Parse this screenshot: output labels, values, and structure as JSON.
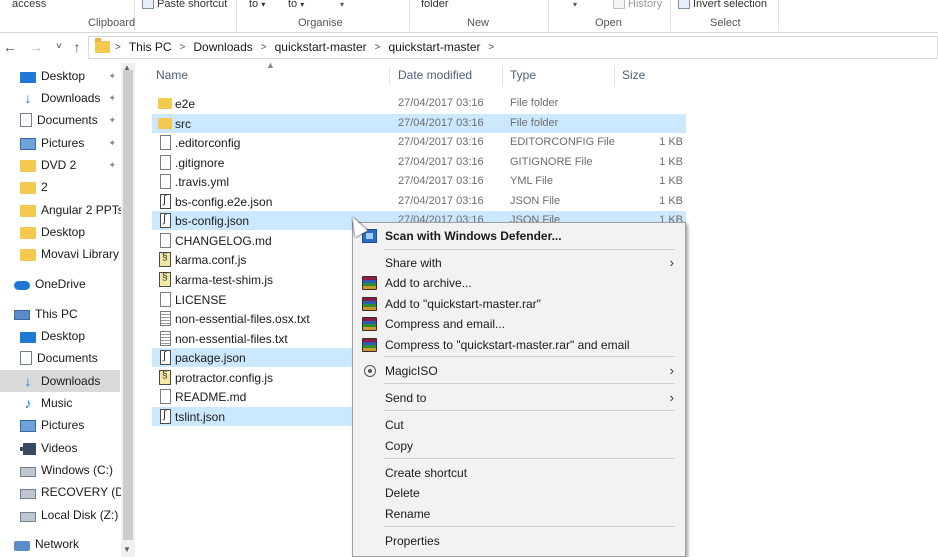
{
  "ribbon": {
    "access_label": "access",
    "paste_shortcut_label": "Paste shortcut",
    "move_to_label": "to",
    "copy_to_label": "to",
    "new_folder_label": "folder",
    "history_label": "History",
    "invert_selection_label": "Invert selection",
    "groups": {
      "clipboard": "Clipboard",
      "organise": "Organise",
      "new": "New",
      "open": "Open",
      "select": "Select"
    }
  },
  "address": {
    "back_icon": "←",
    "forward_icon": "→",
    "recent_icon": "˅",
    "up_icon": "↑",
    "crumbs": [
      "This PC",
      "Downloads",
      "quickstart-master",
      "quickstart-master"
    ],
    "sep": ">"
  },
  "sidebar": {
    "items": [
      {
        "label": "Desktop",
        "icon": "desktop-icon",
        "pinned": true
      },
      {
        "label": "Downloads",
        "icon": "downloads-icon",
        "pinned": true
      },
      {
        "label": "Documents",
        "icon": "documents-icon",
        "pinned": true
      },
      {
        "label": "Pictures",
        "icon": "pictures-icon",
        "pinned": true
      },
      {
        "label": "DVD 2",
        "icon": "folder-icon",
        "pinned": true
      },
      {
        "label": "2",
        "icon": "folder-icon",
        "pinned": false
      },
      {
        "label": "Angular 2 PPTs",
        "icon": "folder-icon",
        "pinned": false
      },
      {
        "label": "Desktop",
        "icon": "folder-icon",
        "pinned": false
      },
      {
        "label": "Movavi Library",
        "icon": "folder-icon",
        "pinned": false
      },
      {
        "label": "OneDrive",
        "icon": "onedrive-icon",
        "pinned": false
      },
      {
        "label": "This PC",
        "icon": "this-pc-icon",
        "pinned": false
      },
      {
        "label": "Desktop",
        "icon": "desktop-icon",
        "pinned": false
      },
      {
        "label": "Documents",
        "icon": "documents-icon",
        "pinned": false
      },
      {
        "label": "Downloads",
        "icon": "downloads-icon",
        "pinned": false
      },
      {
        "label": "Music",
        "icon": "music-icon",
        "pinned": false
      },
      {
        "label": "Pictures",
        "icon": "pictures-icon",
        "pinned": false
      },
      {
        "label": "Videos",
        "icon": "videos-icon",
        "pinned": false
      },
      {
        "label": "Windows (C:)",
        "icon": "drive-icon",
        "pinned": false
      },
      {
        "label": "RECOVERY (D:)",
        "icon": "drive-icon",
        "pinned": false
      },
      {
        "label": "Local Disk (Z:)",
        "icon": "drive-icon",
        "pinned": false
      },
      {
        "label": "Network",
        "icon": "network-icon",
        "pinned": false
      }
    ],
    "selected_index": 13
  },
  "columns": {
    "name": "Name",
    "date": "Date modified",
    "type": "Type",
    "size": "Size"
  },
  "files": [
    {
      "name": "e2e",
      "date": "27/04/2017 03:16",
      "type": "File folder",
      "size": "",
      "kind": "folder",
      "selected": false
    },
    {
      "name": "src",
      "date": "27/04/2017 03:16",
      "type": "File folder",
      "size": "",
      "kind": "folder",
      "selected": true
    },
    {
      "name": ".editorconfig",
      "date": "27/04/2017 03:16",
      "type": "EDITORCONFIG File",
      "size": "1 KB",
      "kind": "file",
      "selected": false
    },
    {
      "name": ".gitignore",
      "date": "27/04/2017 03:16",
      "type": "GITIGNORE File",
      "size": "1 KB",
      "kind": "file",
      "selected": false
    },
    {
      "name": ".travis.yml",
      "date": "27/04/2017 03:16",
      "type": "YML File",
      "size": "1 KB",
      "kind": "file",
      "selected": false
    },
    {
      "name": "bs-config.e2e.json",
      "date": "27/04/2017 03:16",
      "type": "JSON File",
      "size": "1 KB",
      "kind": "json",
      "selected": false
    },
    {
      "name": "bs-config.json",
      "date": "27/04/2017 03:16",
      "type": "JSON File",
      "size": "1 KB",
      "kind": "json",
      "selected": true
    },
    {
      "name": "CHANGELOG.md",
      "date": "",
      "type": "",
      "size": "",
      "kind": "file",
      "selected": false
    },
    {
      "name": "karma.conf.js",
      "date": "",
      "type": "",
      "size": "",
      "kind": "js",
      "selected": false
    },
    {
      "name": "karma-test-shim.js",
      "date": "",
      "type": "",
      "size": "",
      "kind": "js",
      "selected": false
    },
    {
      "name": "LICENSE",
      "date": "",
      "type": "",
      "size": "",
      "kind": "file",
      "selected": false
    },
    {
      "name": "non-essential-files.osx.txt",
      "date": "",
      "type": "",
      "size": "",
      "kind": "text",
      "selected": false
    },
    {
      "name": "non-essential-files.txt",
      "date": "",
      "type": "",
      "size": "",
      "kind": "text",
      "selected": false
    },
    {
      "name": "package.json",
      "date": "",
      "type": "",
      "size": "",
      "kind": "json",
      "selected": true
    },
    {
      "name": "protractor.config.js",
      "date": "",
      "type": "",
      "size": "",
      "kind": "js",
      "selected": false
    },
    {
      "name": "README.md",
      "date": "",
      "type": "",
      "size": "",
      "kind": "file",
      "selected": false
    },
    {
      "name": "tslint.json",
      "date": "",
      "type": "",
      "size": "",
      "kind": "json",
      "selected": true
    }
  ],
  "context_menu": {
    "items": [
      {
        "label": "Scan with Windows Defender...",
        "icon": "windows-defender-icon",
        "bold": true,
        "submenu": false
      },
      {
        "label": "Share with",
        "icon": "",
        "bold": false,
        "submenu": true
      },
      {
        "label": "Add to archive...",
        "icon": "winrar-icon",
        "bold": false,
        "submenu": false
      },
      {
        "label": "Add to \"quickstart-master.rar\"",
        "icon": "winrar-icon",
        "bold": false,
        "submenu": false
      },
      {
        "label": "Compress and email...",
        "icon": "winrar-icon",
        "bold": false,
        "submenu": false
      },
      {
        "label": "Compress to \"quickstart-master.rar\" and email",
        "icon": "winrar-icon",
        "bold": false,
        "submenu": false
      },
      {
        "label": "MagicISO",
        "icon": "magiciso-icon",
        "bold": false,
        "submenu": true
      },
      {
        "label": "Send to",
        "icon": "",
        "bold": false,
        "submenu": true
      },
      {
        "label": "Cut",
        "icon": "",
        "bold": false,
        "submenu": false
      },
      {
        "label": "Copy",
        "icon": "",
        "bold": false,
        "submenu": false
      },
      {
        "label": "Create shortcut",
        "icon": "",
        "bold": false,
        "submenu": false
      },
      {
        "label": "Delete",
        "icon": "",
        "bold": false,
        "submenu": false
      },
      {
        "label": "Rename",
        "icon": "",
        "bold": false,
        "submenu": false
      },
      {
        "label": "Properties",
        "icon": "",
        "bold": false,
        "submenu": false
      }
    ],
    "submenu_arrow": "›"
  },
  "colors": {
    "selection": "#cce8ff",
    "sidebar_selected": "#d9d9d9",
    "menu_bg": "#f2f2f2",
    "folder": "#f3c94f",
    "accent": "#1e78d6"
  }
}
